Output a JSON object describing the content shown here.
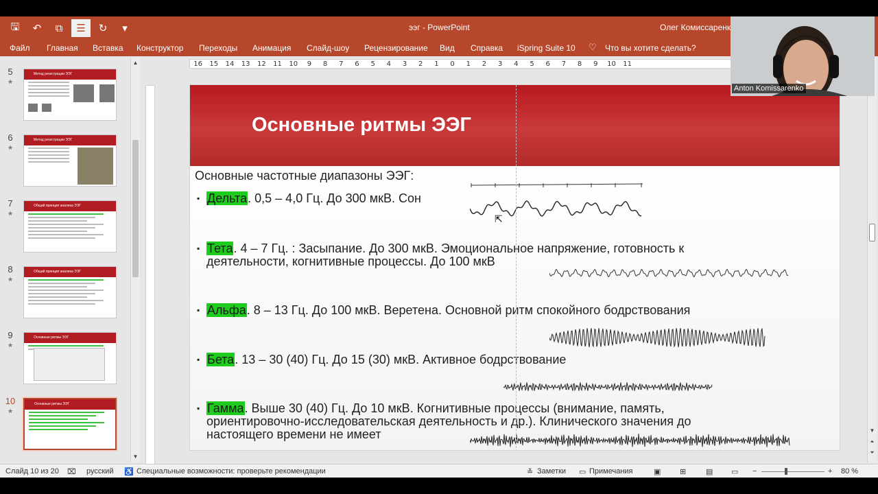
{
  "titlebar": {
    "app_title": "ээг  -  PowerPoint",
    "user": "Олег Комиссаренко",
    "quick_access": [
      {
        "name": "save-icon",
        "glyph": "🖫"
      },
      {
        "name": "undo-icon",
        "glyph": "↶"
      },
      {
        "name": "slideshow-icon",
        "glyph": "⧉"
      },
      {
        "name": "bullets-icon",
        "glyph": "☰"
      },
      {
        "name": "redo-icon",
        "glyph": "↻"
      },
      {
        "name": "customize-icon",
        "glyph": "▾"
      }
    ]
  },
  "menu": {
    "items": [
      "Файл",
      "Главная",
      "Вставка",
      "Конструктор",
      "Переходы",
      "Анимация",
      "Слайд-шоу",
      "Рецензирование",
      "Вид",
      "Справка",
      "iSpring Suite 10"
    ],
    "tell_me": "Что вы хотите сделать?"
  },
  "ruler": {
    "ticks": [
      "16",
      "15",
      "14",
      "13",
      "12",
      "11",
      "10",
      "9",
      "8",
      "7",
      "6",
      "5",
      "4",
      "3",
      "2",
      "1",
      "0",
      "1",
      "2",
      "3",
      "4",
      "5",
      "6",
      "7",
      "8",
      "9",
      "10",
      "11"
    ]
  },
  "thumbnails": [
    {
      "number": "5",
      "title": "Метод регистрации ЭЭГ"
    },
    {
      "number": "6",
      "title": "Метод регистрации ЭЭГ"
    },
    {
      "number": "7",
      "title": "Общий принцип анализа ЭЭГ"
    },
    {
      "number": "8",
      "title": "Общий принцип анализа ЭЭГ"
    },
    {
      "number": "9",
      "title": "Основные ритмы ЭЭГ"
    },
    {
      "number": "10",
      "title": "Основные ритмы ЭЭГ"
    }
  ],
  "slide": {
    "title": "Основные ритмы ЭЭГ",
    "subtitle": "Основные частотные диапазоны ЭЭГ:",
    "rhythms": [
      {
        "name": "Дельта",
        "text_lines": [
          ". 0,5 – 4,0 Гц. До 300 мкВ. Сон"
        ]
      },
      {
        "name": "Тета",
        "text_lines": [
          ". 4 – 7 Гц. : Засыпание. До 300 мкВ. Эмоциональное напряжение, готовность    к",
          "деятельности, когнитивные процессы.  До 100 мкВ"
        ]
      },
      {
        "name": "Альфа",
        "text_lines": [
          ". 8 – 13 Гц. До 100 мкВ. Веретена. Основной ритм спокойного бодрствования"
        ]
      },
      {
        "name": "Бета",
        "text_lines": [
          ". 13 – 30 (40) Гц. До 15 (30) мкВ. Активное бодрствование"
        ]
      },
      {
        "name": "Гамма",
        "text_lines": [
          ". Выше 30 (40) Гц. До 10 мкВ. Когнитивные процессы (внимание, память,",
          "ориентировочно-исследовательская деятельность и др.). Клинического значения до",
          "настоящего времени не имеет"
        ]
      }
    ]
  },
  "webcam": {
    "label": "Anton Komissarenko"
  },
  "status": {
    "slide_info": "Слайд 10 из 20",
    "language": "русский",
    "accessibility": "Специальные возможности: проверьте рекомендации",
    "notes": "Заметки",
    "comments": "Примечания",
    "zoom": "80 %"
  },
  "colors": {
    "ribbon": "#b7472a",
    "slide_header": "#b8191f",
    "highlight": "#1ecc1e"
  }
}
